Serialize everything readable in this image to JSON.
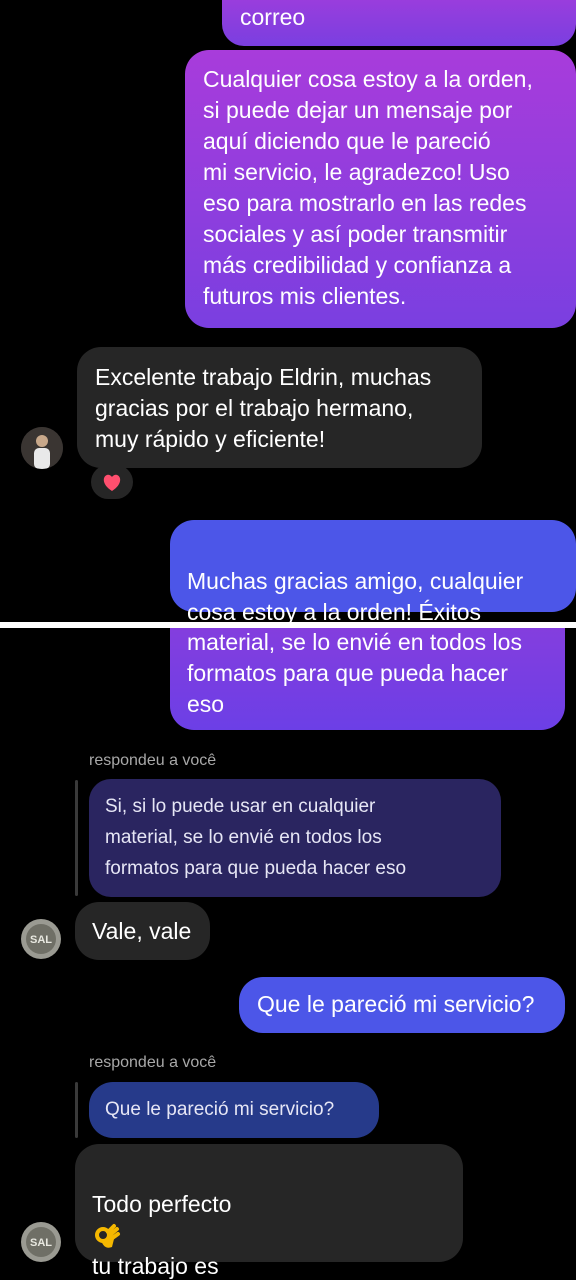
{
  "top": {
    "msg_cut": "correo",
    "msg_out_1": "Cualquier cosa estoy a la orden,\nsi puede dejar un mensaje por\naquí diciendo que le pareció\nmi servicio,  le agradezco! Uso\neso para mostrarlo en las redes\nsociales y así poder transmitir\nmás credibilidad y confianza a\nfuturos mis clientes.",
    "msg_in_1": "Excelente trabajo Eldrin, muchas\ngracias por el trabajo hermano,\nmuy rápido y eficiente!",
    "reaction": "heart",
    "msg_out_2": "Muchas gracias amigo, cualquier\ncosa estoy a la orden! Éxitos"
  },
  "bottom": {
    "msg_cut": "material, se lo envié en todos los\nformatos para que pueda hacer\neso",
    "reply_label_1": "respondeu a você",
    "quote_1": "Si, si lo puede usar en cualquier\nmaterial, se lo envié en todos los\nformatos para que pueda hacer eso",
    "msg_in_1": "Vale, vale",
    "msg_out_1": "Que le pareció mi servicio?",
    "reply_label_2": "respondeu a você",
    "quote_2": "Que le pareció mi servicio?",
    "msg_in_2_a": "Todo perfecto",
    "msg_in_2_b": " tu trabajo es\nadmirable, te deseo mucho más\néxito",
    "avatar_text": "SAL"
  },
  "colors": {
    "outgoing_purple": "#a83cdb",
    "outgoing_blue": "#4c56e8",
    "incoming_gray": "#262626",
    "reply_label": "#a8a8a8"
  }
}
